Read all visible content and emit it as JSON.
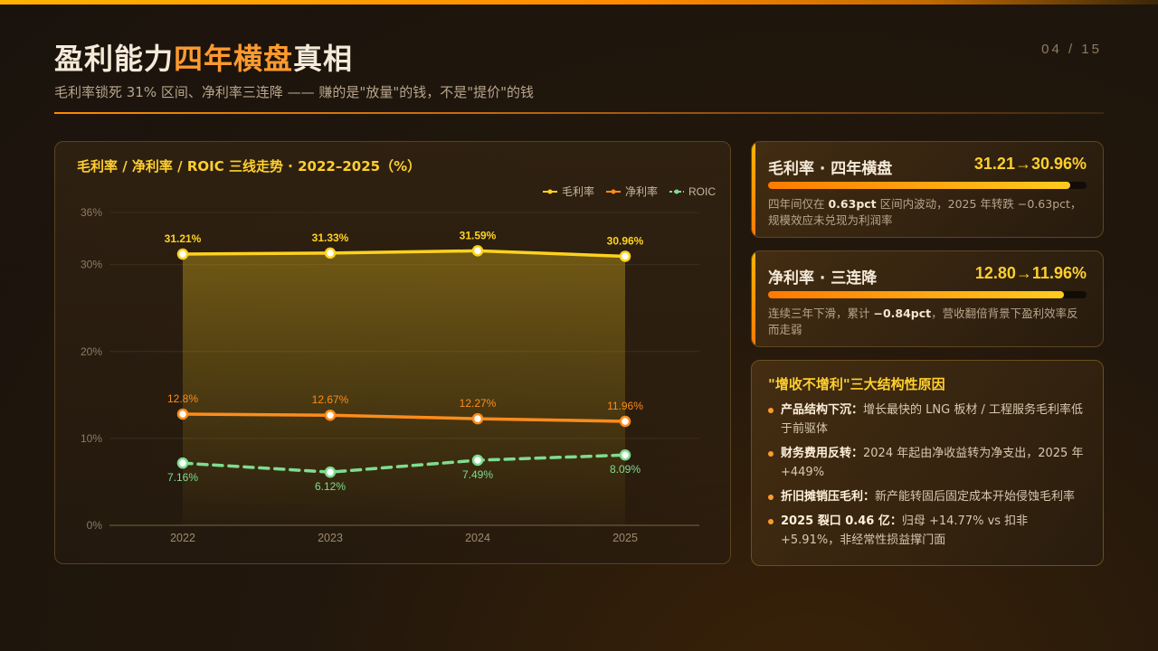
{
  "page_number": "04 / 15",
  "header": {
    "title_pre": "盈利能力",
    "title_highlight": "四年横盘",
    "title_post": "真相",
    "subtitle": "毛利率锁死 31% 区间、净利率三连降 —— 赚的是\"放量\"的钱，不是\"提价\"的钱"
  },
  "chart_data": {
    "type": "line",
    "title": "毛利率 / 净利率 / ROIC 三线走势 · 2022–2025（%）",
    "categories": [
      "2022",
      "2023",
      "2024",
      "2025"
    ],
    "ylim": [
      0,
      36
    ],
    "yticks": [
      0,
      10,
      20,
      30,
      36
    ],
    "ytick_labels": [
      "0%",
      "10%",
      "20%",
      "30%",
      "36%"
    ],
    "grid": true,
    "legend_position": "top-right",
    "series": [
      {
        "name": "毛利率",
        "values": [
          31.21,
          31.33,
          31.59,
          30.96
        ],
        "labels": [
          "31.21%",
          "31.33%",
          "31.59%",
          "30.96%"
        ],
        "color": "#ffd21f",
        "style": "solid",
        "area": true,
        "label_pos": "above"
      },
      {
        "name": "净利率",
        "values": [
          12.8,
          12.67,
          12.27,
          11.96
        ],
        "labels": [
          "12.8%",
          "12.67%",
          "12.27%",
          "11.96%"
        ],
        "color": "#ff8c1a",
        "style": "solid",
        "area": false,
        "label_pos": "above"
      },
      {
        "name": "ROIC",
        "values": [
          7.16,
          6.12,
          7.49,
          8.09
        ],
        "labels": [
          "7.16%",
          "6.12%",
          "7.49%",
          "8.09%"
        ],
        "color": "#7fdc8f",
        "style": "dashed",
        "area": false,
        "label_pos": "below"
      }
    ]
  },
  "cards": [
    {
      "title": "毛利率 · 四年横盘",
      "value": "31.21→30.96%",
      "fill_fraction": 0.95,
      "desc_html": "四年间仅在 <b>0.63pct</b> 区间内波动，2025 年转跌 −0.63pct，规模效应未兑现为利润率"
    },
    {
      "title": "净利率 · 三连降",
      "value": "12.80→11.96%",
      "fill_fraction": 0.93,
      "desc_html": "连续三年下滑，累计 <b>−0.84pct</b>，营收翻倍背景下盈利效率反而走弱"
    }
  ],
  "reasons": {
    "title": "\"增收不增利\"三大结构性原因",
    "items": [
      {
        "title": "产品结构下沉：",
        "text": "增长最快的 LNG 板材 / 工程服务毛利率低于前驱体"
      },
      {
        "title": "财务费用反转：",
        "text": "2024 年起由净收益转为净支出，2025 年 +449%"
      },
      {
        "title": "折旧摊销压毛利：",
        "text": "新产能转固后固定成本开始侵蚀毛利率"
      },
      {
        "title": "2025 裂口 0.46 亿：",
        "text": "归母 +14.77% vs 扣非 +5.91%，非经常性损益撑门面"
      }
    ]
  }
}
